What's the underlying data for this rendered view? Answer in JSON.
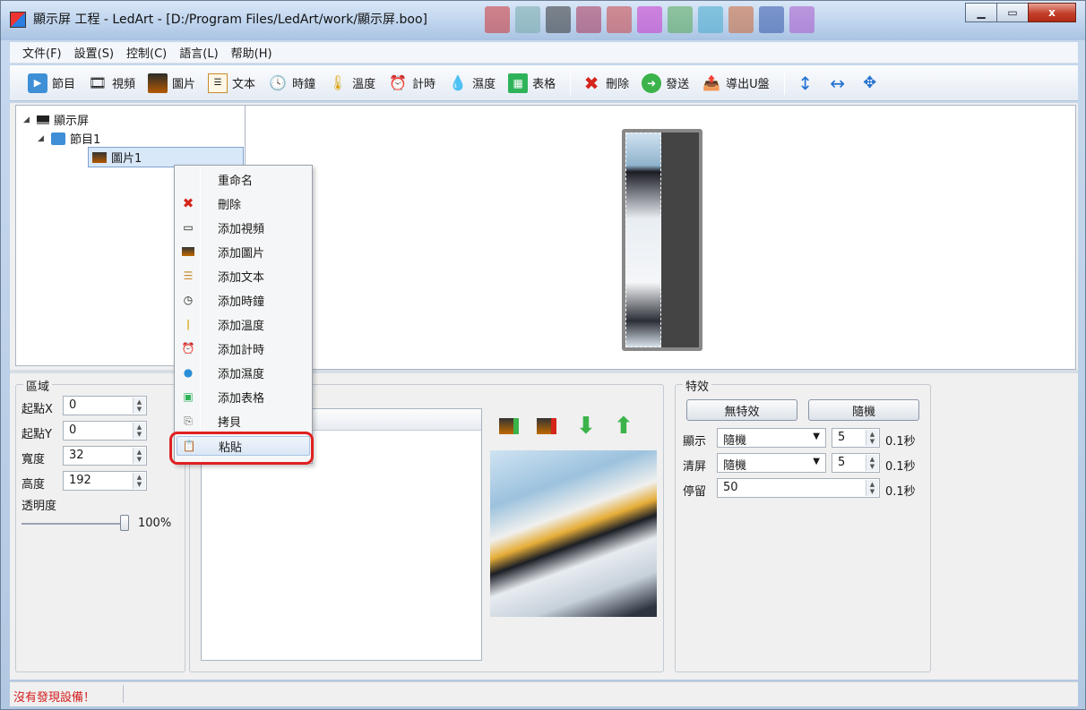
{
  "window": {
    "title": "顯示屏 工程 - LedArt - [D:/Program Files/LedArt/work/顯示屏.boo]",
    "minimize_icon": "minimize-icon",
    "maximize_icon": "maximize-icon",
    "close_label": "x"
  },
  "menu": [
    "文件(F)",
    "設置(S)",
    "控制(C)",
    "語言(L)",
    "帮助(H)"
  ],
  "toolbar": {
    "program": "節目",
    "video": "視頻",
    "picture": "圖片",
    "text": "文本",
    "clock": "時鐘",
    "temperature": "溫度",
    "timer": "計時",
    "humidity": "濕度",
    "table": "表格",
    "delete": "刪除",
    "send": "發送",
    "export_u": "導出U盤"
  },
  "tree": {
    "root": "顯示屏",
    "program": "節目1",
    "picture": "圖片1"
  },
  "area": {
    "title": "區域",
    "x_label": "起點X",
    "x_value": "0",
    "y_label": "起點Y",
    "y_value": "0",
    "width_label": "寬度",
    "width_value": "32",
    "height_label": "高度",
    "height_value": "192",
    "opacity_label": "透明度",
    "opacity_value": "100%",
    "opacity_level": 1.0
  },
  "effects": {
    "title": "特效",
    "no_effect": "無特效",
    "random": "隨機",
    "show_label": "顯示",
    "show_select": "隨機",
    "show_value": "5",
    "show_unit": "0.1秒",
    "clear_label": "清屏",
    "clear_select": "隨機",
    "clear_value": "5",
    "clear_unit": "0.1秒",
    "stay_label": "停留",
    "stay_value": "50",
    "stay_unit": "0.1秒"
  },
  "context_menu": [
    {
      "label": "重命名",
      "icon": ""
    },
    {
      "label": "刪除",
      "icon": "delete-x-icon"
    },
    {
      "label": "添加視頻",
      "icon": "video-icon"
    },
    {
      "label": "添加圖片",
      "icon": "picture-icon"
    },
    {
      "label": "添加文本",
      "icon": "text-icon"
    },
    {
      "label": "添加時鐘",
      "icon": "clock-icon"
    },
    {
      "label": "添加溫度",
      "icon": "thermometer-icon"
    },
    {
      "label": "添加計時",
      "icon": "alarm-clock-icon"
    },
    {
      "label": "添加濕度",
      "icon": "droplet-icon"
    },
    {
      "label": "添加表格",
      "icon": "table-icon"
    },
    {
      "label": "拷貝",
      "icon": "copy-icon"
    },
    {
      "label": "粘貼",
      "icon": "paste-icon"
    }
  ],
  "colors": {
    "accent_red": "#e02020",
    "status_red": "#d21d1d",
    "selection": "#d8e8f9"
  },
  "status": "沒有發現設備！"
}
